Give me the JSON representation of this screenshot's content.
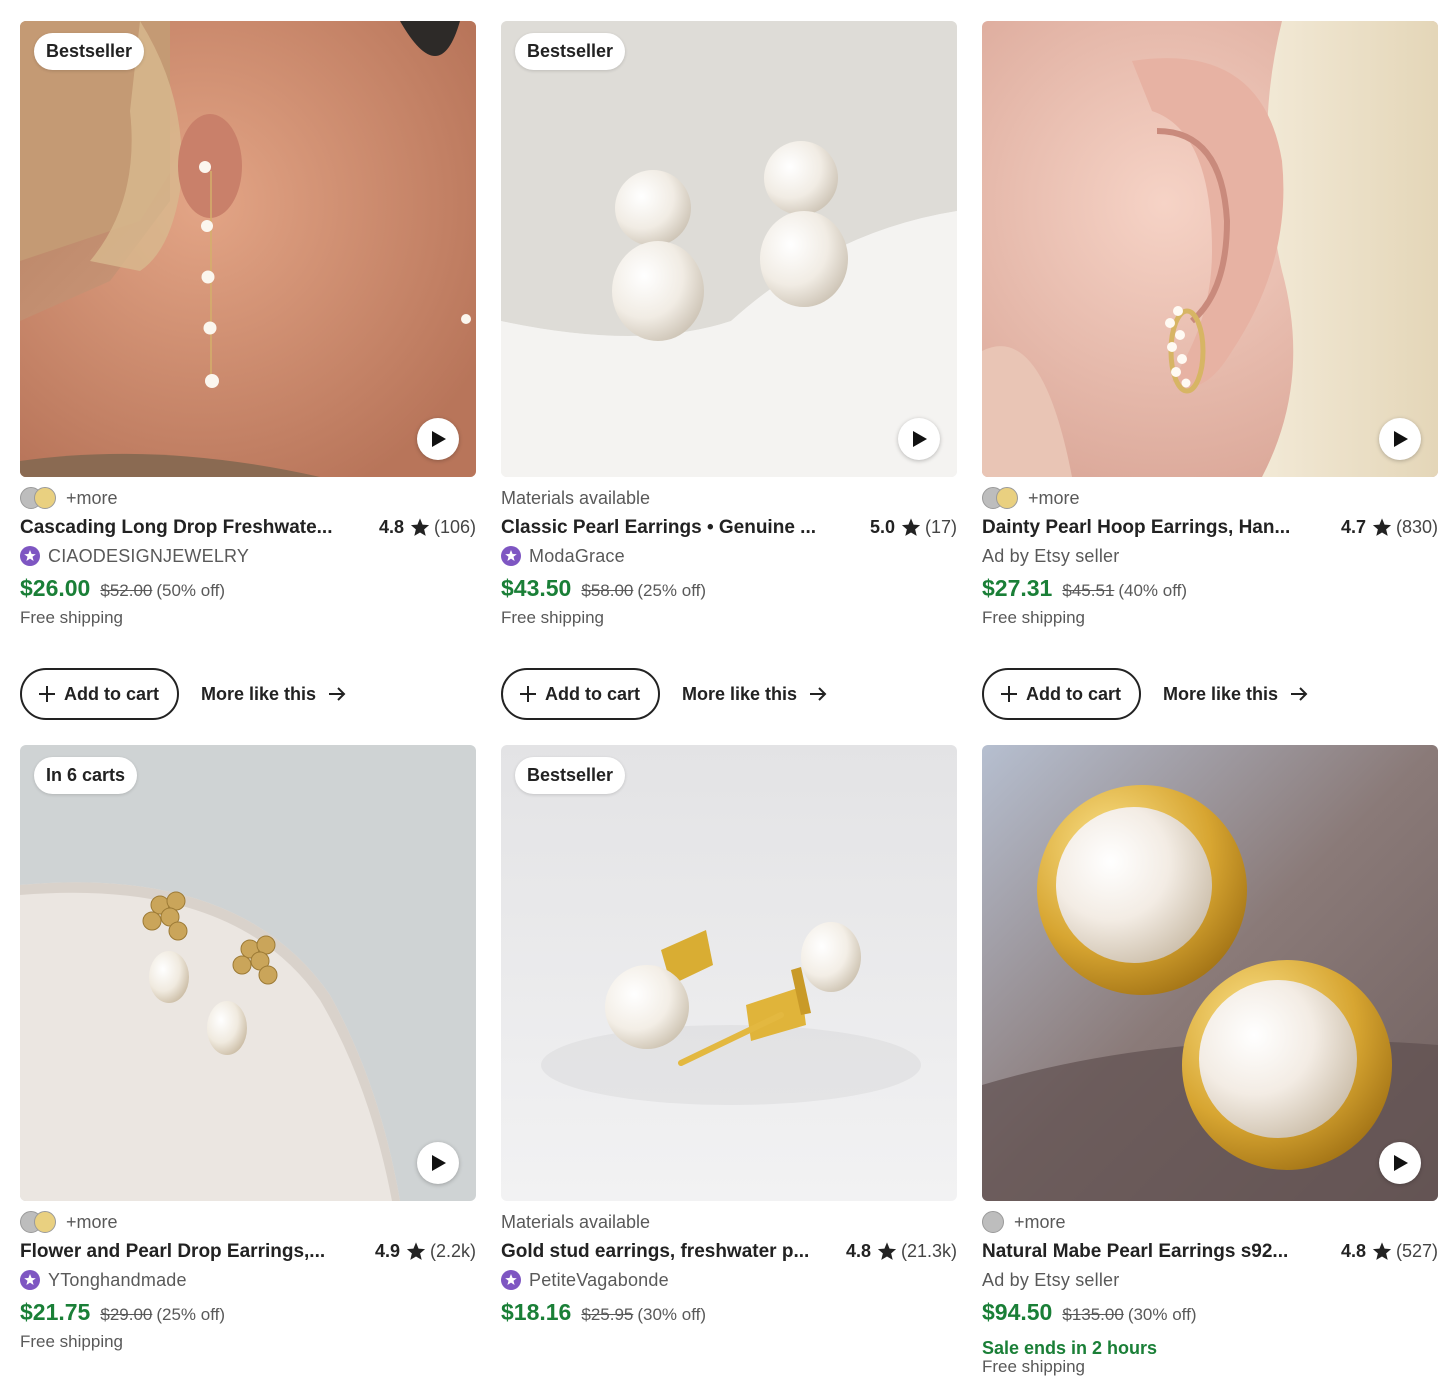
{
  "colors": {
    "price_green": "#1a7f37",
    "star_shop_purple": "#7e56c2",
    "text_dark": "#222222",
    "text_muted": "#595959"
  },
  "icons": {
    "play": "play-icon",
    "star": "star-icon",
    "plus": "plus-icon",
    "arrow": "arrow-right-icon",
    "star_seller": "star-seller-icon"
  },
  "labels": {
    "add_to_cart": "Add to cart",
    "more_like_this": "More like this"
  },
  "listings": [
    {
      "badge": "Bestseller",
      "more": "+more",
      "title": "Cascading Long Drop Freshwate...",
      "rating": "4.8",
      "reviews": "(106)",
      "shop": "CIAODESIGNJEWELRY",
      "price": "$26.00",
      "old_price": "$52.00",
      "discount": "(50% off)",
      "shipping": "Free shipping"
    },
    {
      "badge": "Bestseller",
      "materials": "Materials available",
      "title": "Classic Pearl Earrings • Genuine ...",
      "rating": "5.0",
      "reviews": "(17)",
      "shop": "ModaGrace",
      "price": "$43.50",
      "old_price": "$58.00",
      "discount": "(25% off)",
      "shipping": "Free shipping"
    },
    {
      "more": "+more",
      "title": "Dainty Pearl Hoop Earrings, Han...",
      "rating": "4.7",
      "reviews": "(830)",
      "ad": "Ad by Etsy seller",
      "price": "$27.31",
      "old_price": "$45.51",
      "discount": "(40% off)",
      "shipping": "Free shipping"
    },
    {
      "badge": "In 6 carts",
      "more": "+more",
      "title": "Flower and Pearl Drop Earrings,...",
      "rating": "4.9",
      "reviews": "(2.2k)",
      "shop": "YTonghandmade",
      "price": "$21.75",
      "old_price": "$29.00",
      "discount": "(25% off)",
      "shipping": "Free shipping"
    },
    {
      "badge": "Bestseller",
      "materials": "Materials available",
      "title": "Gold stud earrings, freshwater p...",
      "rating": "4.8",
      "reviews": "(21.3k)",
      "shop": "PetiteVagabonde",
      "price": "$18.16",
      "old_price": "$25.95",
      "discount": "(30% off)"
    },
    {
      "more": "+more",
      "title": "Natural Mabe Pearl Earrings s92...",
      "rating": "4.8",
      "reviews": "(527)",
      "ad": "Ad by Etsy seller",
      "price": "$94.50",
      "old_price": "$135.00",
      "discount": "(30% off)",
      "sale": "Sale ends in 2 hours",
      "shipping": "Free shipping"
    }
  ]
}
